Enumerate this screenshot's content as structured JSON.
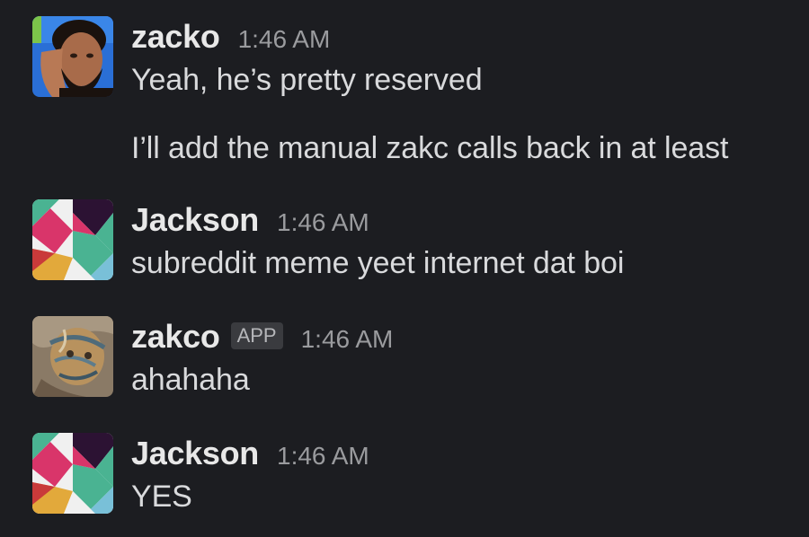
{
  "messages": [
    {
      "author": "zacko",
      "time": "1:46 AM",
      "lines": [
        "Yeah, he’s pretty reserved",
        "I’ll add the manual zakc calls back in at least"
      ],
      "avatar": "portrait-photo"
    },
    {
      "author": "Jackson",
      "time": "1:46 AM",
      "lines": [
        "subreddit meme yeet internet dat boi"
      ],
      "avatar": "slack-pattern-avatar"
    },
    {
      "author": "zakco",
      "badge": "APP",
      "time": "1:46 AM",
      "lines": [
        "ahahaha"
      ],
      "avatar": "painted-portrait"
    },
    {
      "author": "Jackson",
      "time": "1:46 AM",
      "lines": [
        "YES"
      ],
      "avatar": "slack-pattern-avatar"
    }
  ],
  "colors": {
    "background": "#1c1d21",
    "author": "#e8e8e8",
    "text": "#d9dadc",
    "timestamp": "#9a9b9e",
    "badge_bg": "#3a3b3f"
  }
}
